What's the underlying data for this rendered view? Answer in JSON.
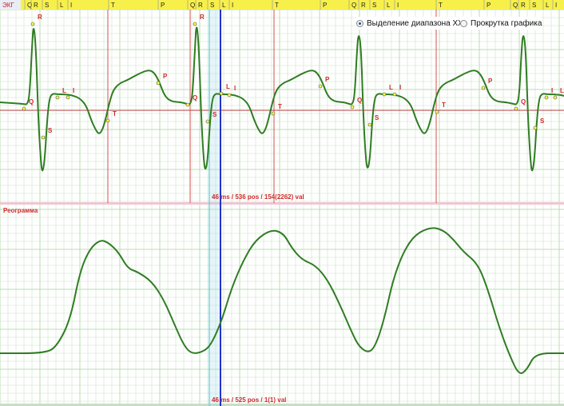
{
  "chart_data": [
    {
      "type": "line",
      "panel": "ecg",
      "title": "ЭКГ",
      "topbar_markers": [
        "Q",
        "R",
        "S",
        "L",
        "I",
        "T",
        "P",
        "Q",
        "R",
        "S",
        "L",
        "I",
        "T",
        "P",
        "Q",
        "R",
        "S",
        "L",
        "I",
        "T",
        "P",
        "Q",
        "R",
        "S",
        "L",
        "I"
      ],
      "wave_labels": [
        {
          "text": "R",
          "wave": "R"
        },
        {
          "text": "Q",
          "wave": "Q"
        },
        {
          "text": "S",
          "wave": "S"
        },
        {
          "text": "L",
          "wave": "L"
        },
        {
          "text": "I",
          "wave": "I"
        },
        {
          "text": "T",
          "wave": "T"
        },
        {
          "text": "P",
          "wave": "P"
        },
        {
          "text": "R",
          "wave": "R"
        },
        {
          "text": "Q",
          "wave": "Q"
        },
        {
          "text": "S",
          "wave": "S"
        },
        {
          "text": "L",
          "wave": "L"
        },
        {
          "text": "I",
          "wave": "I"
        },
        {
          "text": "T",
          "wave": "T"
        },
        {
          "text": "P",
          "wave": "P"
        },
        {
          "text": "Q",
          "wave": "Q"
        },
        {
          "text": "S",
          "wave": "S"
        },
        {
          "text": "L",
          "wave": "L"
        },
        {
          "text": "I",
          "wave": "I"
        },
        {
          "text": "T",
          "wave": "T"
        },
        {
          "text": "P",
          "wave": "P"
        },
        {
          "text": "Q",
          "wave": "Q"
        },
        {
          "text": "S",
          "wave": "S"
        },
        {
          "text": "I",
          "wave": "I"
        },
        {
          "text": "L",
          "wave": "L"
        }
      ],
      "readout": "46 ms / 536 pos / 154(2262) val",
      "line_color": "#2f7d22",
      "grid_color": "#b9dcb2",
      "marker_color": "#cc2a2a"
    },
    {
      "type": "line",
      "panel": "rheo",
      "title": "Реограмма",
      "readout": "46 ms / 525 pos / 1(1) val",
      "line_color": "#2f7d22",
      "grid_color": "#b9dcb2"
    }
  ],
  "controls": {
    "range_select_label": "Выделение диапазона XX",
    "scroll_label": "Прокрутка графика",
    "selected": "range_select"
  }
}
